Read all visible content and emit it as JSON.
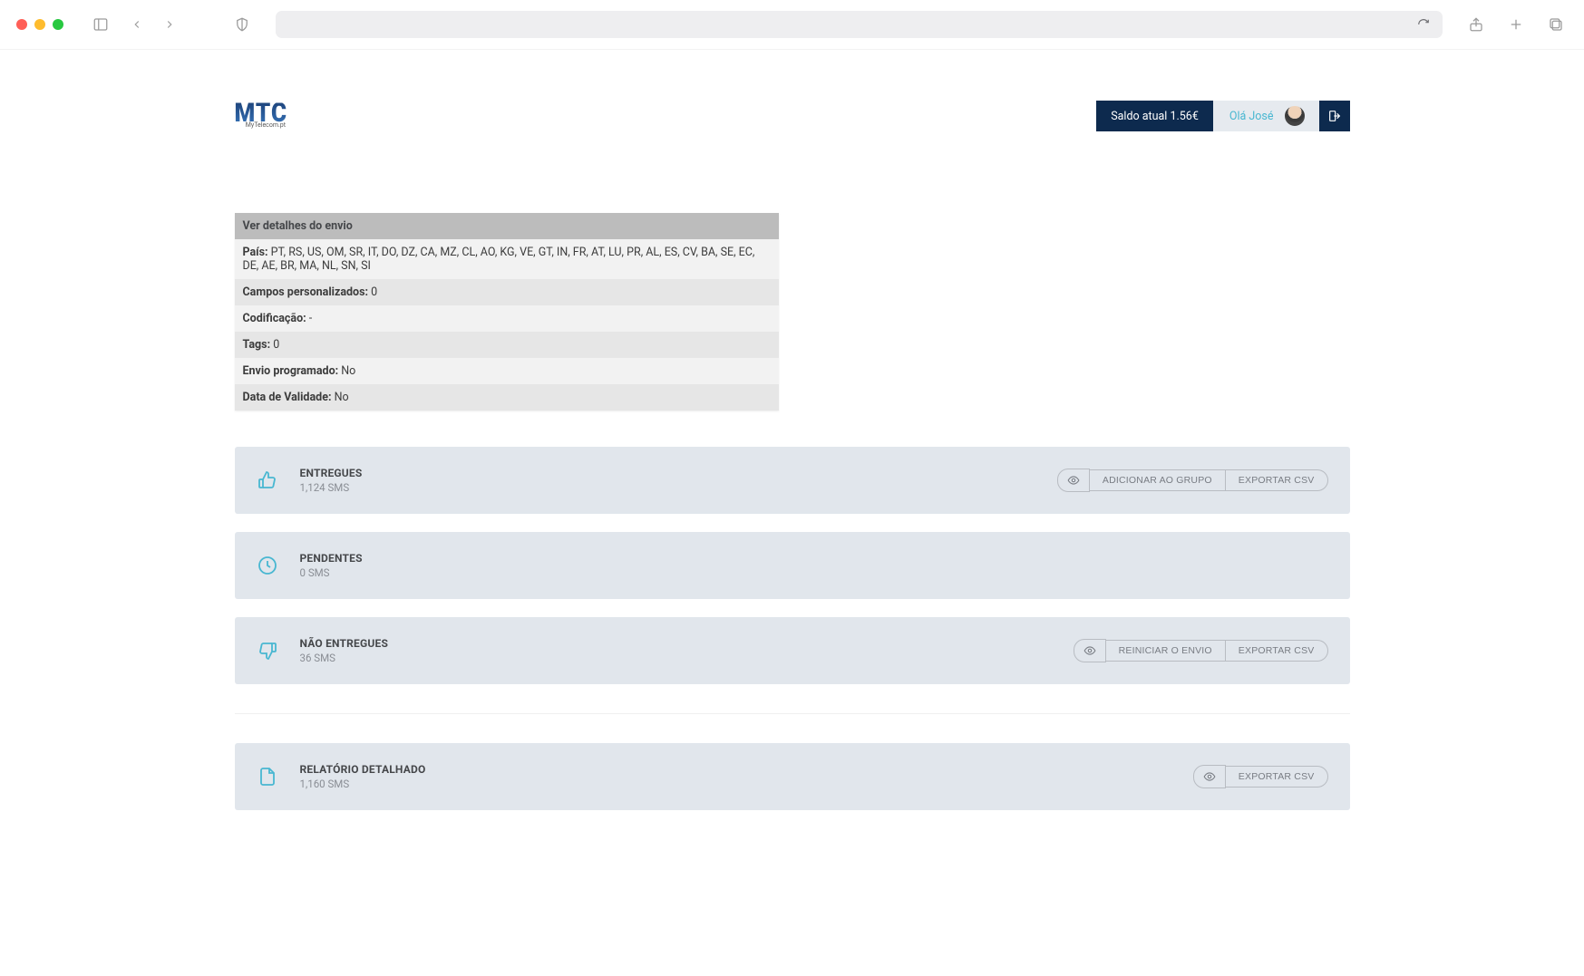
{
  "logo": {
    "mark": "MTC",
    "sub": "MyTelecom.pt"
  },
  "account": {
    "balance": "Saldo atual 1.56€",
    "greeting": "Olá José"
  },
  "details": {
    "header": "Ver detalhes do envio",
    "rows": [
      {
        "k": "País",
        "v": "PT, RS, US, OM, SR, IT, DO, DZ, CA, MZ, CL, AO, KG, VE, GT, IN, FR, AT, LU, PR, AL, ES, CV, BA, SE, EC, DE, AE, BR, MA, NL, SN, SI"
      },
      {
        "k": "Campos personalizados",
        "v": "0"
      },
      {
        "k": "Codificação",
        "v": "-"
      },
      {
        "k": "Tags",
        "v": "0"
      },
      {
        "k": "Envio programado",
        "v": "No"
      },
      {
        "k": "Data de Validade",
        "v": "No"
      }
    ]
  },
  "cards": {
    "delivered": {
      "title": "ENTREGUES",
      "count": "1,124 SMS",
      "add_group": "ADICIONAR AO GRUPO",
      "export": "EXPORTAR CSV"
    },
    "pending": {
      "title": "PENDENTES",
      "count": "0 SMS"
    },
    "undelivered": {
      "title": "NÃO ENTREGUES",
      "count": "36 SMS",
      "retry": "REINICIAR O ENVIO",
      "export": "EXPORTAR CSV"
    },
    "report": {
      "title": "RELATÓRIO DETALHADO",
      "count": "1,160 SMS",
      "export": "EXPORTAR CSV"
    }
  }
}
